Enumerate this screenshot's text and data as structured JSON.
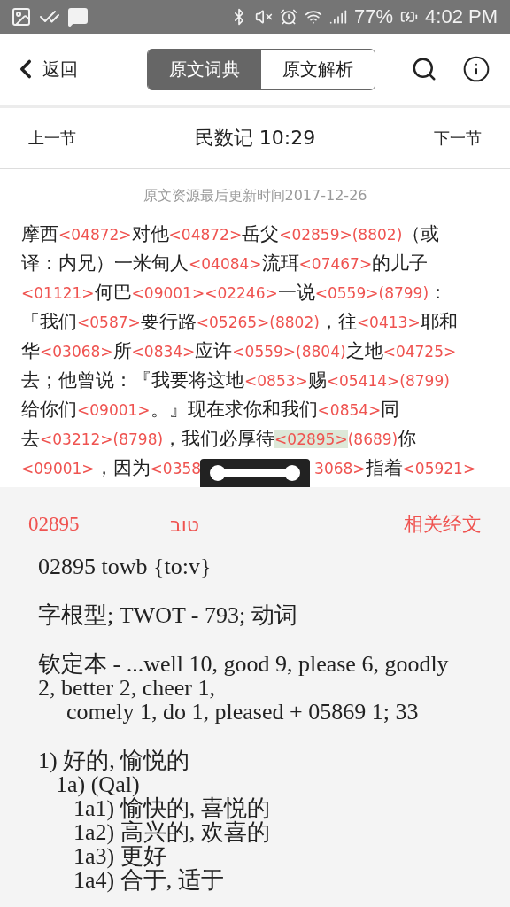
{
  "status_bar": {
    "battery": "77%",
    "time": "4:02 PM"
  },
  "header": {
    "back": "返回",
    "tabs": [
      {
        "label": "原文词典",
        "selected": true
      },
      {
        "label": "原文解析",
        "selected": false
      }
    ]
  },
  "nav": {
    "prev": "上一节",
    "title": "民数记 10:29",
    "next": "下一节"
  },
  "update_note": "原文资源最后更新时间2017-12-26",
  "verse_lines": [
    [
      {
        "kind": "word",
        "text": "摩西"
      },
      {
        "kind": "code",
        "text": "<04872>",
        "selected": false
      },
      {
        "kind": "word",
        "text": "对他"
      },
      {
        "kind": "code",
        "text": "<04872>",
        "selected": false
      },
      {
        "kind": "word",
        "text": "岳父"
      },
      {
        "kind": "code",
        "text": "<02859>",
        "selected": false
      },
      {
        "kind": "code",
        "text": "(8802)",
        "selected": false
      },
      {
        "kind": "word",
        "text": "（或"
      }
    ],
    [
      {
        "kind": "word",
        "text": "译：内兄）一米甸人"
      },
      {
        "kind": "code",
        "text": "<04084>",
        "selected": false
      },
      {
        "kind": "word",
        "text": "流珥"
      },
      {
        "kind": "code",
        "text": "<07467>",
        "selected": false
      },
      {
        "kind": "word",
        "text": "的儿子"
      }
    ],
    [
      {
        "kind": "code",
        "text": "<01121>",
        "selected": false
      },
      {
        "kind": "word",
        "text": "何巴"
      },
      {
        "kind": "code",
        "text": "<09001>",
        "selected": false
      },
      {
        "kind": "code",
        "text": "<02246>",
        "selected": false
      },
      {
        "kind": "word",
        "text": "一说"
      },
      {
        "kind": "code",
        "text": "<0559>",
        "selected": false
      },
      {
        "kind": "code",
        "text": "(8799)",
        "selected": false
      },
      {
        "kind": "word",
        "text": "："
      }
    ],
    [
      {
        "kind": "word",
        "text": "「我们"
      },
      {
        "kind": "code",
        "text": "<0587>",
        "selected": false
      },
      {
        "kind": "word",
        "text": "要行路"
      },
      {
        "kind": "code",
        "text": "<05265>",
        "selected": false
      },
      {
        "kind": "code",
        "text": "(8802)",
        "selected": false
      },
      {
        "kind": "word",
        "text": "，往"
      },
      {
        "kind": "code",
        "text": "<0413>",
        "selected": false
      },
      {
        "kind": "word",
        "text": "耶和"
      }
    ],
    [
      {
        "kind": "word",
        "text": "华"
      },
      {
        "kind": "code",
        "text": "<03068>",
        "selected": false
      },
      {
        "kind": "word",
        "text": "所"
      },
      {
        "kind": "code",
        "text": "<0834>",
        "selected": false
      },
      {
        "kind": "word",
        "text": "应许"
      },
      {
        "kind": "code",
        "text": "<0559>",
        "selected": false
      },
      {
        "kind": "code",
        "text": "(8804)",
        "selected": false
      },
      {
        "kind": "word",
        "text": "之地"
      },
      {
        "kind": "code",
        "text": "<04725>",
        "selected": false
      }
    ],
    [
      {
        "kind": "word",
        "text": "去；他曾说：『我要将这地"
      },
      {
        "kind": "code",
        "text": "<0853>",
        "selected": false
      },
      {
        "kind": "word",
        "text": "赐"
      },
      {
        "kind": "code",
        "text": "<05414>",
        "selected": false
      },
      {
        "kind": "code",
        "text": "(8799)",
        "selected": false
      }
    ],
    [
      {
        "kind": "word",
        "text": "给你们"
      },
      {
        "kind": "code",
        "text": "<09001>",
        "selected": false
      },
      {
        "kind": "word",
        "text": "。』现在求你和我们"
      },
      {
        "kind": "code",
        "text": "<0854>",
        "selected": false
      },
      {
        "kind": "word",
        "text": "同"
      }
    ],
    [
      {
        "kind": "word",
        "text": "去"
      },
      {
        "kind": "code",
        "text": "<03212>",
        "selected": false
      },
      {
        "kind": "code",
        "text": "(8798)",
        "selected": false
      },
      {
        "kind": "word",
        "text": "，我们必厚待"
      },
      {
        "kind": "code",
        "text": "<02895>",
        "selected": true
      },
      {
        "kind": "code",
        "text": "(8689)",
        "selected": false
      },
      {
        "kind": "word",
        "text": "你"
      }
    ],
    [
      {
        "kind": "code",
        "text": "<09001>",
        "selected": false
      },
      {
        "kind": "word",
        "text": "，因为"
      },
      {
        "kind": "code",
        "text": "<0358",
        "selected": false
      },
      {
        "kind": "covered"
      },
      {
        "kind": "code",
        "text": "3068>",
        "selected": false
      },
      {
        "kind": "word",
        "text": "指着"
      },
      {
        "kind": "code",
        "text": "<05921>",
        "selected": false
      }
    ]
  ],
  "detail": {
    "number": "02895",
    "hebrew": "טוב",
    "related": "相关经文",
    "heading": "02895 towb {to:v}",
    "grammar": "字根型; TWOT - 793; 动词",
    "kjv": {
      "text": "钦定本 - ...well 10, good 9, please 6, goodly 2, better 2, cheer 1,",
      "continuation": "comely 1, do 1, pleased + 05869 1; 33"
    },
    "senses": [
      {
        "text": "1) 好的, 愉悦的",
        "children": [
          {
            "text": "1a) (Qal)",
            "children": [
              {
                "text": "1a1) 愉快的, 喜悦的"
              },
              {
                "text": "1a2) 高兴的, 欢喜的"
              },
              {
                "text": "1a3) 更好"
              },
              {
                "text": "1a4) 合于, 适于"
              }
            ]
          }
        ]
      }
    ]
  }
}
